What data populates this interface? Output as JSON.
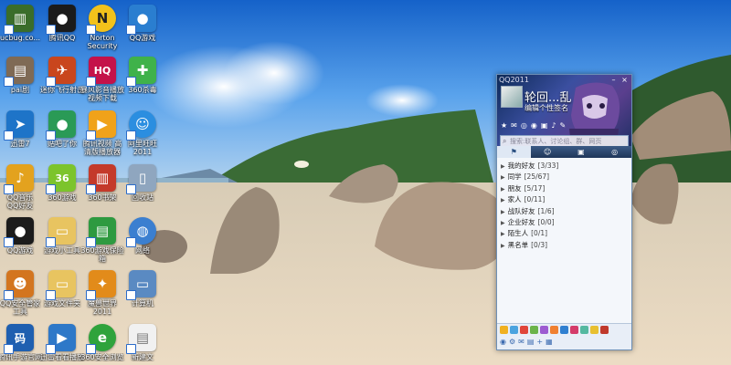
{
  "desktop": {
    "icons": [
      {
        "label": "ucbug.co...",
        "color": "#3a6d2a",
        "glyph": "▥",
        "icon": "winrar-icon"
      },
      {
        "label": "腾讯QQ",
        "color": "#1b1b1b",
        "glyph": "●",
        "icon": "qq-penguin-icon"
      },
      {
        "label": "Norton",
        "label2": "Security",
        "color": "#f2c21b",
        "glyph": "N",
        "icon": "norton-icon"
      },
      {
        "label": "QQ游戏",
        "color": "#2a7ed0",
        "glyph": "●",
        "icon": "qq-game-icon"
      },
      {
        "label": "pai剧",
        "color": "#7f6a55",
        "glyph": "▤",
        "icon": "photo-icon"
      },
      {
        "label": "迷你飞行射击",
        "color": "#c9461d",
        "glyph": "✈",
        "icon": "plane-icon"
      },
      {
        "label": "暴风影音播放",
        "label2": "视频下载",
        "color": "#c4124a",
        "glyph": "HQ",
        "icon": "hq-player-icon"
      },
      {
        "label": "360杀毒",
        "color": "#3fb24a",
        "glyph": "✚",
        "icon": "shield-360-icon"
      },
      {
        "label": "迅雷7",
        "color": "#1e74c8",
        "glyph": "➤",
        "icon": "thunder-icon"
      },
      {
        "label": "贴吧了你",
        "color": "#2a9a56",
        "glyph": "●",
        "icon": "pet-icon"
      },
      {
        "label": "腾讯视频 高",
        "label2": "清版播放器",
        "color": "#f0a21a",
        "glyph": "▶",
        "icon": "tencent-video-icon"
      },
      {
        "label": "阿里旺旺",
        "label2": "2011",
        "color": "#2b8ee0",
        "glyph": "☺",
        "icon": "wangwang-icon"
      },
      {
        "label": "QQ音乐",
        "label2": "QQ好友",
        "color": "#e3a21e",
        "glyph": "♪",
        "icon": "qq-music-icon"
      },
      {
        "label": "360游戏",
        "color": "#7cc42c",
        "glyph": "36",
        "icon": "360-game-icon"
      },
      {
        "label": "360书架",
        "color": "#c43a2a",
        "glyph": "▥",
        "icon": "bookshelf-icon"
      },
      {
        "label": "回收站",
        "color": "#8fa6bf",
        "glyph": "🗑",
        "icon": "recycle-bin-icon"
      },
      {
        "label": "QQ游戏",
        "color": "#1b1b1b",
        "glyph": "●",
        "icon": "qq-penguin-icon-2"
      },
      {
        "label": "游戏小工具",
        "color": "#e8c460",
        "glyph": "▭",
        "icon": "folder-icon"
      },
      {
        "label": "360游戏保险",
        "label2": "箱",
        "color": "#2e9a40",
        "glyph": "▤",
        "icon": "safe-box-icon"
      },
      {
        "label": "网络",
        "color": "#3b7fd0",
        "glyph": "◍",
        "icon": "network-icon"
      },
      {
        "label": "QQ安全管家",
        "label2": "工具",
        "color": "#d3751f",
        "glyph": "☻",
        "icon": "qq-guard-icon"
      },
      {
        "label": "游戏文件夹",
        "color": "#e8c460",
        "glyph": "▭",
        "icon": "folder-icon-2"
      },
      {
        "label": "魔兽世界",
        "label2": "2011",
        "color": "#e28b1a",
        "glyph": "✦",
        "icon": "wow-icon"
      },
      {
        "label": "计算机",
        "color": "#5a8ac2",
        "glyph": "▭",
        "icon": "computer-icon"
      },
      {
        "label": "腾讯手游官网",
        "color": "#1f5fb0",
        "glyph": "码",
        "icon": "game-icon"
      },
      {
        "label": "迅雷看看播放",
        "color": "#2e78c8",
        "glyph": "▶",
        "icon": "kankan-icon"
      },
      {
        "label": "360安全浏览",
        "color": "#2fa33c",
        "glyph": "e",
        "icon": "browser-360-icon"
      },
      {
        "label": "新建文",
        "color": "#f1f1f1",
        "glyph": "▤",
        "icon": "text-file-icon"
      }
    ]
  },
  "qq_panel": {
    "title": "QQ2011",
    "nickname": "轮回...乱",
    "signature": "编辑个性签名",
    "search_placeholder": "搜索:联系人、讨论组、群、网页",
    "tabs": [
      "⚑",
      "☺",
      "▣",
      "◎"
    ],
    "groups": [
      {
        "name": "我的好友",
        "count": "[3/33]"
      },
      {
        "name": "同学",
        "count": "[25/67]"
      },
      {
        "name": "朋友",
        "count": "[5/17]"
      },
      {
        "name": "家人",
        "count": "[0/11]"
      },
      {
        "name": "战队好友",
        "count": "[1/6]"
      },
      {
        "name": "企业好友",
        "count": "[0/0]"
      },
      {
        "name": "陌生人",
        "count": "[0/1]"
      },
      {
        "name": "黑名单",
        "count": "[0/3]"
      }
    ],
    "app_colors": [
      "#f0b020",
      "#4aa3df",
      "#e0453a",
      "#6ab34a",
      "#9c5bd1",
      "#f08030",
      "#2f7fd0",
      "#d43b6a",
      "#54b8a0",
      "#e8c030",
      "#c0392b"
    ]
  }
}
